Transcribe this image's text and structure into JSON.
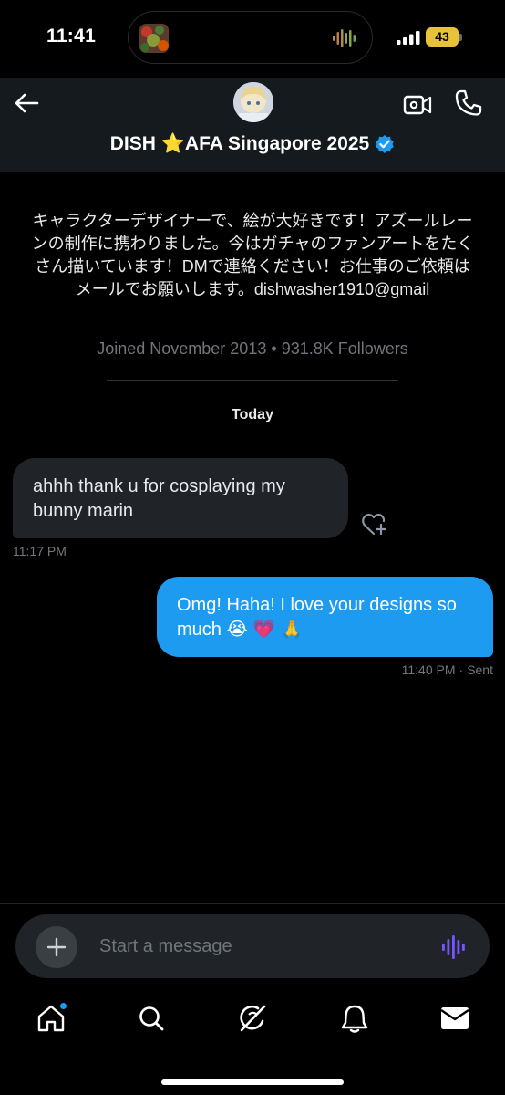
{
  "status_bar": {
    "time": "11:41",
    "battery": "43",
    "icons": [
      "signal-icon",
      "battery-icon",
      "audio-wave-icon"
    ]
  },
  "header": {
    "name": "DISH ⭐AFA Singapore 2025",
    "verified": true,
    "icons": [
      "back-arrow-icon",
      "video-call-icon",
      "phone-call-icon",
      "verified-badge-icon"
    ]
  },
  "profile": {
    "bio": "キャラクターデザイナーで、絵が大好きです！アズールレーンの制作に携わりました。今はガチャのファンアートをたくさん描いています！DMで連絡ください！お仕事のご依頼はメールでお願いします。dishwasher1910@gmail",
    "joined": "Joined November 2013",
    "separator": "•",
    "followers": "931.8K Followers"
  },
  "conversation": {
    "date_label": "Today",
    "messages": [
      {
        "direction": "incoming",
        "text": "ahhh thank u for cosplaying my bunny marin",
        "time": "11:17 PM"
      },
      {
        "direction": "outgoing",
        "text": "Omg! Haha! I love your designs so much 😭 💗 🙏",
        "time": "11:40 PM",
        "status": "Sent",
        "separator": "·"
      }
    ]
  },
  "composer": {
    "placeholder": "Start a message",
    "icons": [
      "plus-icon",
      "voice-wave-icon"
    ]
  },
  "bottom_nav": {
    "items": [
      "home-icon",
      "search-icon",
      "grok-icon",
      "notifications-icon",
      "messages-icon"
    ],
    "active": "messages-icon",
    "home_has_dot": true
  },
  "colors": {
    "accent": "#1d9bf0",
    "background": "#000000",
    "header_bg": "#151a1f",
    "incoming_bubble": "#202327",
    "muted_text": "#71767b",
    "voice_icon": "#7856ff",
    "battery": "#e8c33a"
  }
}
